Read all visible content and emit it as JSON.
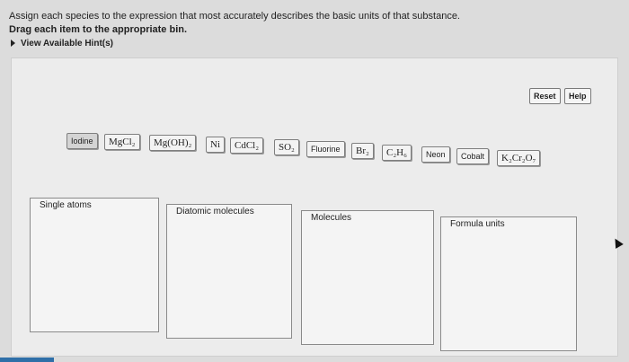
{
  "instructions": {
    "line1": "Assign each species to the expression that most accurately describes the basic units of that substance.",
    "line2": "Drag each item to the appropriate bin."
  },
  "hints": {
    "label": "View Available Hint(s)"
  },
  "toolbar": {
    "reset_label": "Reset",
    "help_label": "Help"
  },
  "chips": [
    {
      "id": "iodine",
      "label": "Iodine"
    },
    {
      "id": "mgcl2",
      "label": "MgCl₂"
    },
    {
      "id": "mgoh2",
      "label": "Mg(OH)₂"
    },
    {
      "id": "ni",
      "label": "Ni"
    },
    {
      "id": "cdcl2",
      "label": "CdCl₂"
    },
    {
      "id": "so2",
      "label": "SO₂"
    },
    {
      "id": "fluorine",
      "label": "Fluorine"
    },
    {
      "id": "br2",
      "label": "Br₂"
    },
    {
      "id": "c2h6",
      "label": "C₂H₆"
    },
    {
      "id": "neon",
      "label": "Neon"
    },
    {
      "id": "cobalt",
      "label": "Cobalt"
    },
    {
      "id": "k2cr2o7",
      "label": "K₂Cr₂O₇"
    }
  ],
  "bins": [
    {
      "id": "single-atoms",
      "label": "Single atoms"
    },
    {
      "id": "diatomic",
      "label": "Diatomic molecules"
    },
    {
      "id": "molecules",
      "label": "Molecules"
    },
    {
      "id": "formula-units",
      "label": "Formula units"
    }
  ]
}
